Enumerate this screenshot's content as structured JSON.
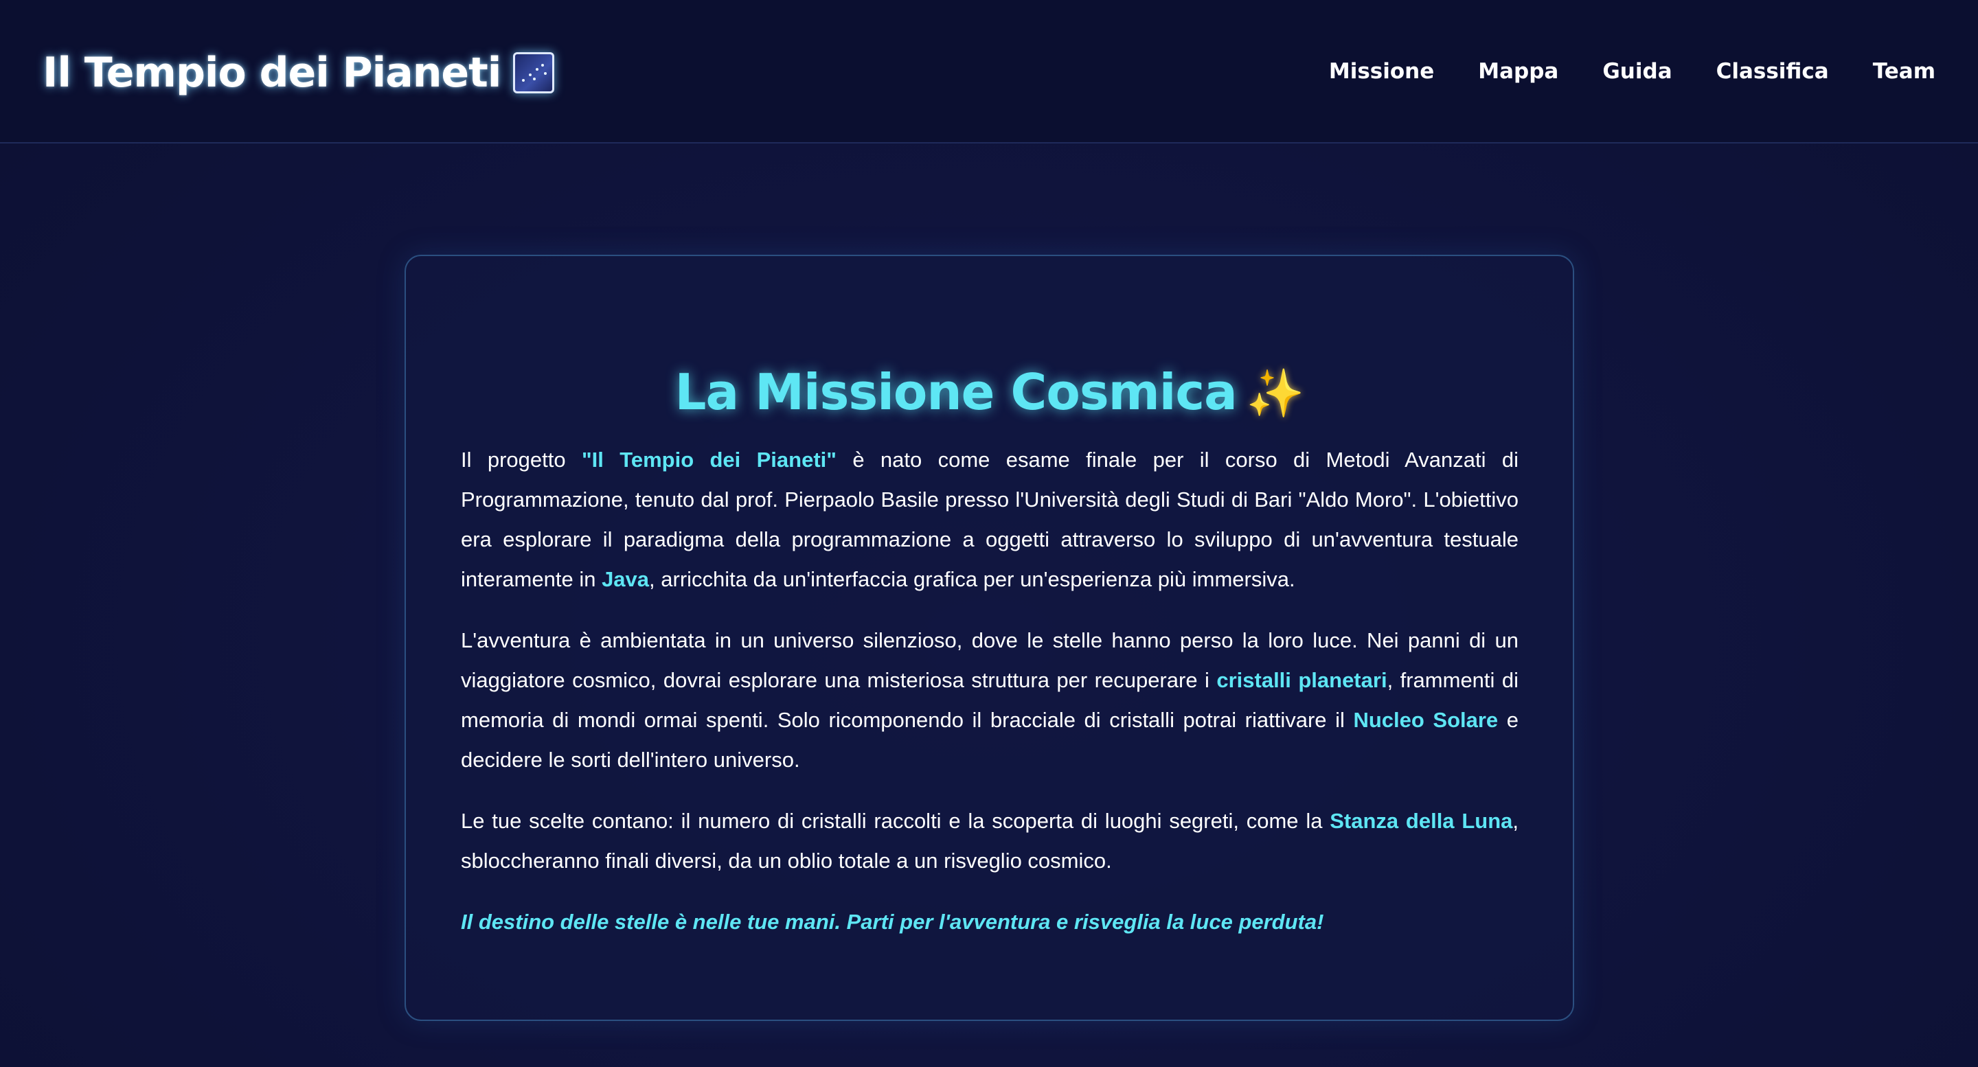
{
  "header": {
    "title": "Il Tempio dei Pianeti",
    "logo_icon": "galaxy-image-icon",
    "nav": [
      {
        "label": "Missione"
      },
      {
        "label": "Mappa"
      },
      {
        "label": "Guida"
      },
      {
        "label": "Classifica"
      },
      {
        "label": "Team"
      }
    ]
  },
  "mission": {
    "title": "La Missione Cosmica",
    "title_icon": "sparkles-icon",
    "p1": {
      "t1": "Il progetto ",
      "h1": "\"Il Tempio dei Pianeti\"",
      "t2": " è nato come esame finale per il corso di Metodi Avanzati di Programmazione, tenuto dal prof. Pierpaolo Basile presso l'Università degli Studi di Bari \"Aldo Moro\". L'obiettivo era esplorare il paradigma della programmazione a oggetti attraverso lo sviluppo di un'avventura testuale interamente in ",
      "h2": "Java",
      "t3": ", arricchita da un'interfaccia grafica per un'esperienza più immersiva."
    },
    "p2": {
      "t1": "L'avventura è ambientata in un universo silenzioso, dove le stelle hanno perso la loro luce. Nei panni di un viaggiatore cosmico, dovrai esplorare una misteriosa struttura per recuperare i ",
      "h1": "cristalli planetari",
      "t2": ", frammenti di memoria di mondi ormai spenti. Solo ricomponendo il bracciale di cristalli potrai riattivare il ",
      "h2": "Nucleo Solare",
      "t3": " e decidere le sorti dell'intero universo."
    },
    "p3": {
      "t1": "Le tue scelte contano: il numero di cristalli raccolti e la scoperta di luoghi segreti, come la ",
      "h1": "Stanza della Luna",
      "t2": ", sbloccheranno finali diversi, da un oblio totale a un risveglio cosmico."
    },
    "closing": "Il destino delle stelle è nelle tue mani. Parti per l'avventura e risveglia la luce perduta!"
  },
  "colors": {
    "accent": "#5ee6f4",
    "background": "#10143d",
    "header_bg": "#0b0f30",
    "card_border": "#2b4f80",
    "sparkle": "#ffd34d"
  }
}
